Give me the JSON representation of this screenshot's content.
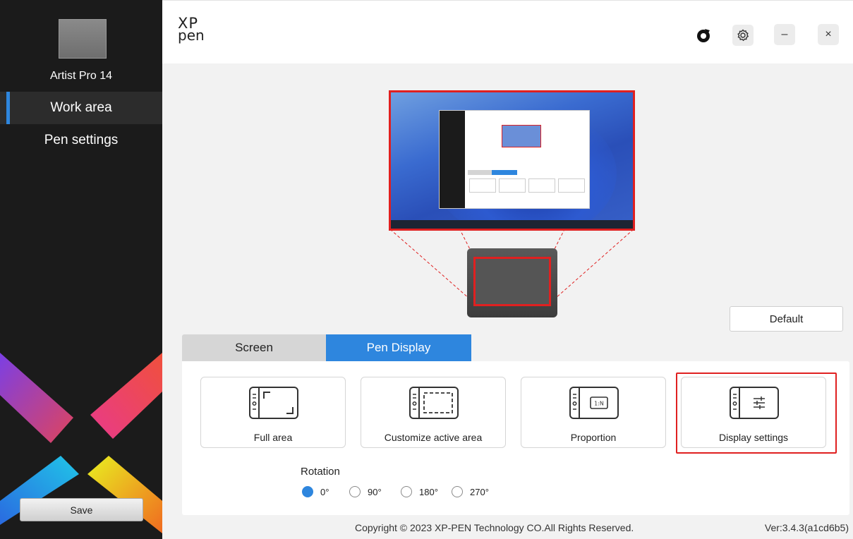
{
  "sidebar": {
    "device_name": "Artist Pro 14",
    "items": [
      {
        "label": "Work area",
        "active": true
      },
      {
        "label": "Pen settings",
        "active": false
      }
    ],
    "save_label": "Save"
  },
  "header": {
    "logo_line1": "XP",
    "logo_line2": "pen",
    "icons": [
      "pen-brand-icon",
      "gear-icon"
    ],
    "minimize_label": "–",
    "close_label": "×"
  },
  "workarea": {
    "default_label": "Default",
    "tabs": [
      {
        "label": "Screen",
        "active": false
      },
      {
        "label": "Pen Display",
        "active": true
      }
    ],
    "modes": [
      {
        "label": "Full area",
        "icon": "full-area-icon"
      },
      {
        "label": "Customize active area",
        "icon": "customize-area-icon"
      },
      {
        "label": "Proportion",
        "icon": "proportion-icon",
        "glyph_text": "1:N"
      },
      {
        "label": "Display settings",
        "icon": "display-settings-icon",
        "highlighted": true
      }
    ],
    "rotation": {
      "label": "Rotation",
      "options": [
        "0°",
        "90°",
        "180°",
        "270°"
      ],
      "selected": "0°"
    }
  },
  "footer": {
    "copyright": "Copyright © 2023  XP-PEN Technology CO.All Rights Reserved.",
    "version": "Ver:3.4.3(a1cd6b5)"
  },
  "colors": {
    "accent": "#2e86de",
    "highlight": "#e02020",
    "sidebar_bg": "#1b1b1b"
  }
}
